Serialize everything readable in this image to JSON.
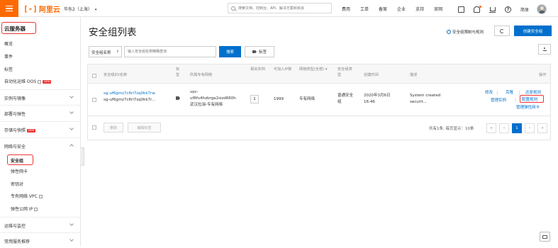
{
  "topbar": {
    "logo_mark": "[-]",
    "logo_text": "阿里云",
    "region": "华东2（上海）",
    "region_caret": "▾",
    "search_placeholder": "搜索文档、控制台、API、解决方案和资源",
    "nav": [
      "费用",
      "工单",
      "备案",
      "企业",
      "支持",
      "官网"
    ],
    "icons": [
      "mail-icon",
      "bell-icon",
      "cart-icon",
      "help-icon"
    ],
    "lang": "简体",
    "accent_color": "#ff6a00"
  },
  "sidebar": {
    "title": "云服务器",
    "items_top": [
      "概览",
      "事件",
      "标签",
      "自动化运维 OOS"
    ],
    "new_badge": "NEW",
    "groups": [
      {
        "label": "实例与镜像",
        "expanded": false
      },
      {
        "label": "部署与弹性",
        "expanded": false
      },
      {
        "label": "存储与快照",
        "expanded": false,
        "badge": "NEW"
      },
      {
        "label": "网络与安全",
        "expanded": true
      },
      {
        "label": "运维与监控",
        "expanded": false
      },
      {
        "label": "常用服务推荐",
        "expanded": false
      }
    ],
    "network_items": [
      "安全组",
      "弹性网卡",
      "密钥对",
      "专有网络 VPC",
      "弹性公网 IP"
    ],
    "active_item": "安全组"
  },
  "main": {
    "title": "安全组列表",
    "doc_link": "安全组限制与规则",
    "create_button": "创建安全组",
    "filter_select": "安全组名称",
    "filter_caret": "⇕",
    "filter_placeholder": "输入安全组名称精确查询",
    "search_button": "搜索",
    "tag_button": "标签",
    "primary_color": "#0070cc",
    "highlight_color": "#ee3333"
  },
  "table": {
    "headers": {
      "id_name": "安全组ID/名称",
      "tag": "标签",
      "vpc": "所属专有网络",
      "instances": "相关实例",
      "available_ips": "可加入IP数",
      "network_type": "网络类型(全部) ▾",
      "group_type": "安全组类型",
      "created": "创建时间",
      "description": "描述",
      "actions": "操作"
    },
    "rows": [
      {
        "id": "sg-uf6gmz7c6rl7sq0kk7rw",
        "name": "sg-uf6gmz7c6rl7sq0kk7r...",
        "vpc_id": "vpc-",
        "vpc_id_2": "uf6fv4hzbrga2sizd660h",
        "vpc_name": "武汉拉油-专有网络",
        "instances": "1",
        "available_ips": "1999",
        "network_type": "专有网络",
        "group_type": "普通安全",
        "group_type_2": "组",
        "created_date": "2020年3月6日",
        "created_time": "16:46",
        "description": "System created",
        "description_2": "securit...",
        "actions": {
          "modify": "修改",
          "clone": "克隆",
          "restore": "还原规则",
          "manage_instances": "管理实例",
          "configure_rules": "配置规则",
          "manage_eni": "管理弹性网卡"
        }
      }
    ],
    "footer": {
      "delete": "删除",
      "edit_tags": "编辑标签",
      "summary": "共有1条, 每页显示：10条",
      "pages": [
        "«",
        "‹",
        "1",
        "›",
        "»"
      ],
      "current_page": "1"
    }
  }
}
